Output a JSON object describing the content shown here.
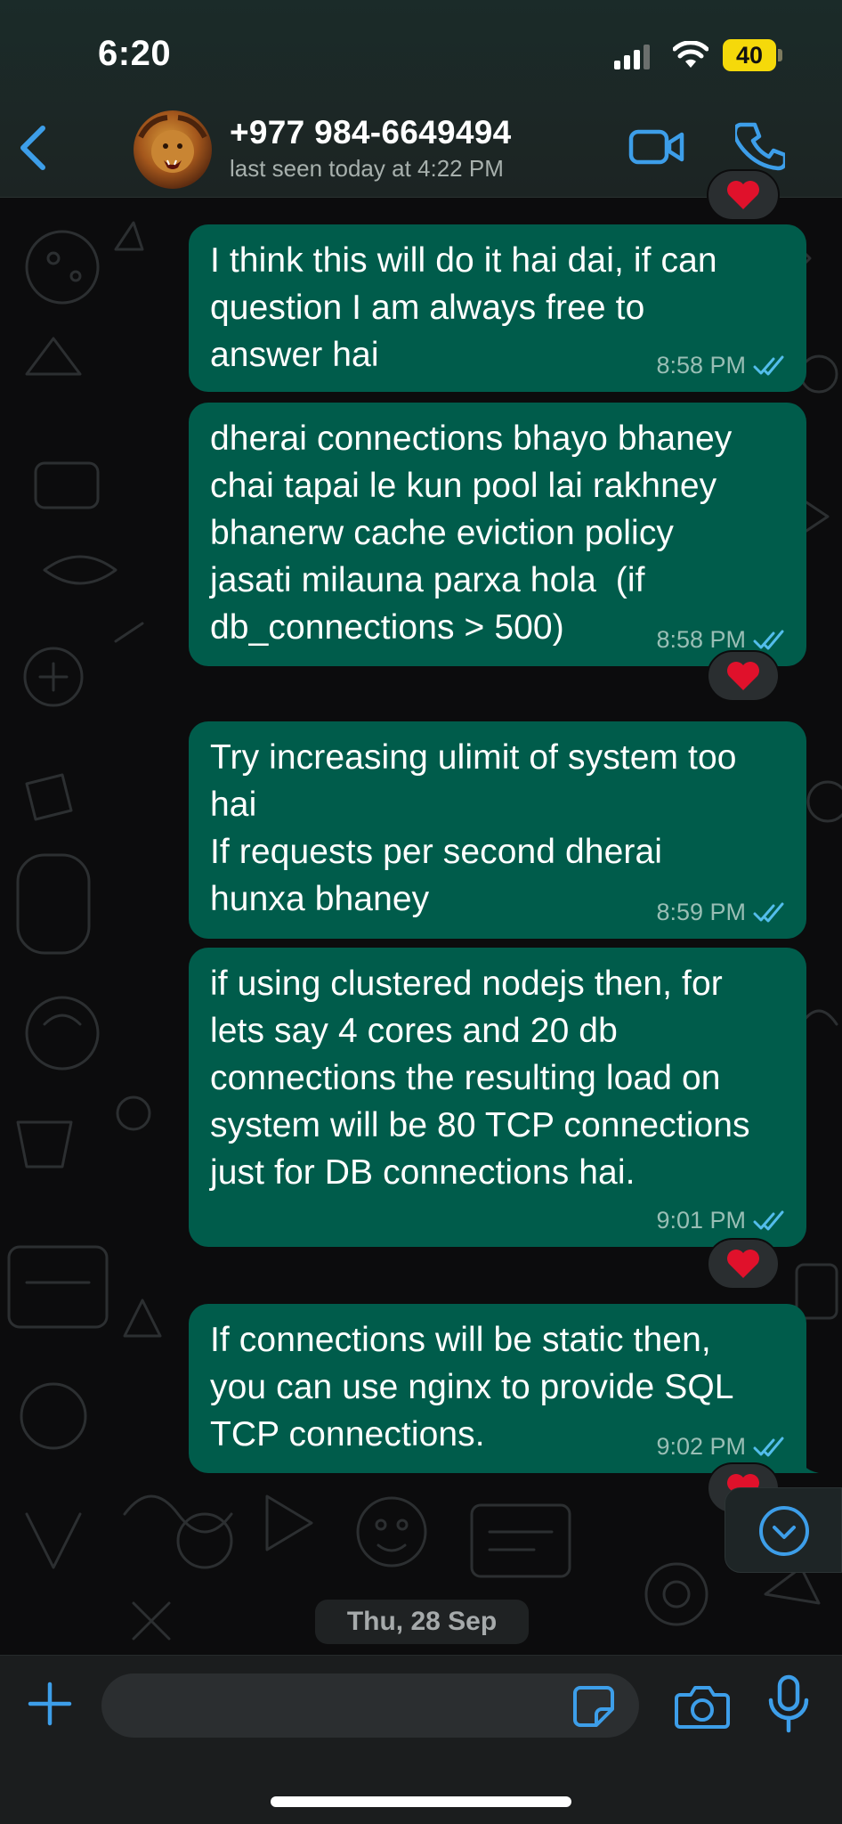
{
  "status_bar": {
    "time": "6:20",
    "battery": "40"
  },
  "header": {
    "contact_name": "+977 984-6649494",
    "last_seen": "last seen today at 4:22 PM"
  },
  "messages": [
    {
      "text": "I think this will do it hai dai, if can\nquestion I am always free to\nanswer hai",
      "time": "8:58 PM",
      "reaction": ""
    },
    {
      "text": "dherai connections bhayo bhaney\nchai tapai le kun pool lai rakhney\nbhanerw cache eviction policy\njasati milauna parxa hola  (if\ndb_connections > 500)",
      "time": "8:58 PM",
      "reaction": "heart"
    },
    {
      "text": "Try increasing ulimit of system too\nhai\nIf requests per second dherai\nhunxa bhaney",
      "time": "8:59 PM",
      "reaction": ""
    },
    {
      "text": "if using clustered nodejs then, for\nlets say 4 cores and 20 db\nconnections the resulting load on\nsystem will be 80 TCP connections\njust for DB connections hai.",
      "time": "9:01 PM",
      "reaction": "heart"
    },
    {
      "text": "If connections will be static then,\nyou can use nginx to provide SQL\nTCP connections.",
      "time": "9:02 PM",
      "reaction": "heart"
    }
  ],
  "date_separator": "Thu, 28 Sep",
  "input": {
    "value": "",
    "placeholder": ""
  },
  "colors": {
    "outgoing_bubble": "#005c4b",
    "accent_blue": "#3d9ee9",
    "read_ticks": "#53bdeb",
    "battery": "#f5d90a"
  },
  "icons": {
    "back": "chevron-left-icon",
    "video": "video-camera-icon",
    "call": "phone-icon",
    "plus": "plus-icon",
    "sticker": "sticker-icon",
    "camera": "camera-icon",
    "mic": "microphone-icon",
    "scroll": "chevron-down-circle-icon",
    "reaction": "heart-icon",
    "ticks": "double-check-icon"
  }
}
